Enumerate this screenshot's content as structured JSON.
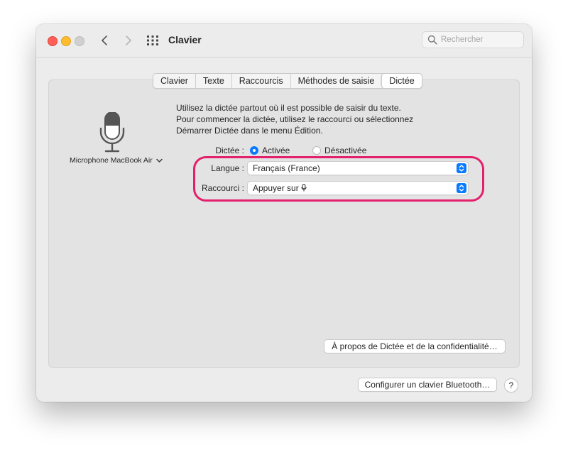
{
  "window": {
    "title": "Clavier"
  },
  "search": {
    "placeholder": "Rechercher"
  },
  "tabs": [
    {
      "label": "Clavier"
    },
    {
      "label": "Texte"
    },
    {
      "label": "Raccourcis"
    },
    {
      "label": "Méthodes de saisie"
    },
    {
      "label": "Dictée",
      "selected": true
    }
  ],
  "microphone": {
    "source_label": "Microphone MacBook Air"
  },
  "description": {
    "line1": "Utilisez la dictée partout où il est possible de saisir du texte.",
    "line2": "Pour commencer la dictée, utilisez le raccourci ou sélectionnez",
    "line3": "Démarrer Dictée dans le menu Édition."
  },
  "dictation": {
    "label": "Dictée :",
    "on_label": "Activée",
    "off_label": "Désactivée",
    "selected": "on"
  },
  "language": {
    "label": "Langue :",
    "value": "Français (France)"
  },
  "shortcut": {
    "label": "Raccourci :",
    "value": "Appuyer sur"
  },
  "about_button": {
    "label": "À propos de Dictée et de la confidentialité…"
  },
  "bluetooth_button": {
    "label": "Configurer un clavier Bluetooth…"
  },
  "help_button": {
    "label": "?"
  },
  "colors": {
    "accent": "#0a7aff",
    "highlight": "#e3206b"
  }
}
